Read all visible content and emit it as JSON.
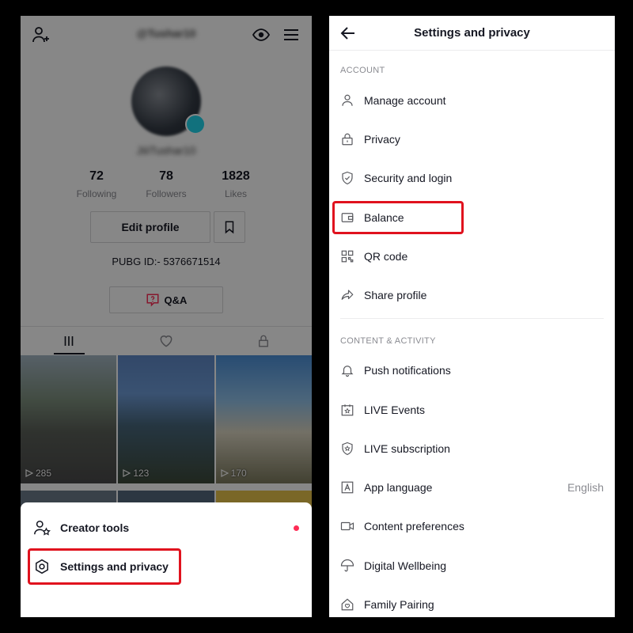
{
  "left": {
    "username": "@Tushar10",
    "handle": "JiiiTushar10",
    "stats": [
      {
        "num": "72",
        "label": "Following"
      },
      {
        "num": "78",
        "label": "Followers"
      },
      {
        "num": "1828",
        "label": "Likes"
      }
    ],
    "edit_profile": "Edit profile",
    "bio": "PUBG ID:- 5376671514",
    "qa_label": "Q&A",
    "videos": [
      {
        "views": "285"
      },
      {
        "views": "123"
      },
      {
        "views": "170"
      }
    ],
    "sheet": {
      "creator_tools": "Creator tools",
      "settings": "Settings and privacy"
    }
  },
  "right": {
    "title": "Settings and privacy",
    "section_account": "ACCOUNT",
    "section_content": "CONTENT & ACTIVITY",
    "items": {
      "manage": "Manage account",
      "privacy": "Privacy",
      "security": "Security and login",
      "balance": "Balance",
      "qr": "QR code",
      "share": "Share profile",
      "push": "Push notifications",
      "live_events": "LIVE Events",
      "live_sub": "LIVE subscription",
      "language": "App language",
      "language_value": "English",
      "content_pref": "Content preferences",
      "wellbeing": "Digital Wellbeing",
      "family": "Family Pairing"
    }
  },
  "colors": {
    "highlight": "#e0121e",
    "accent_red": "#fe2c55",
    "badge": "#20d5ec"
  }
}
